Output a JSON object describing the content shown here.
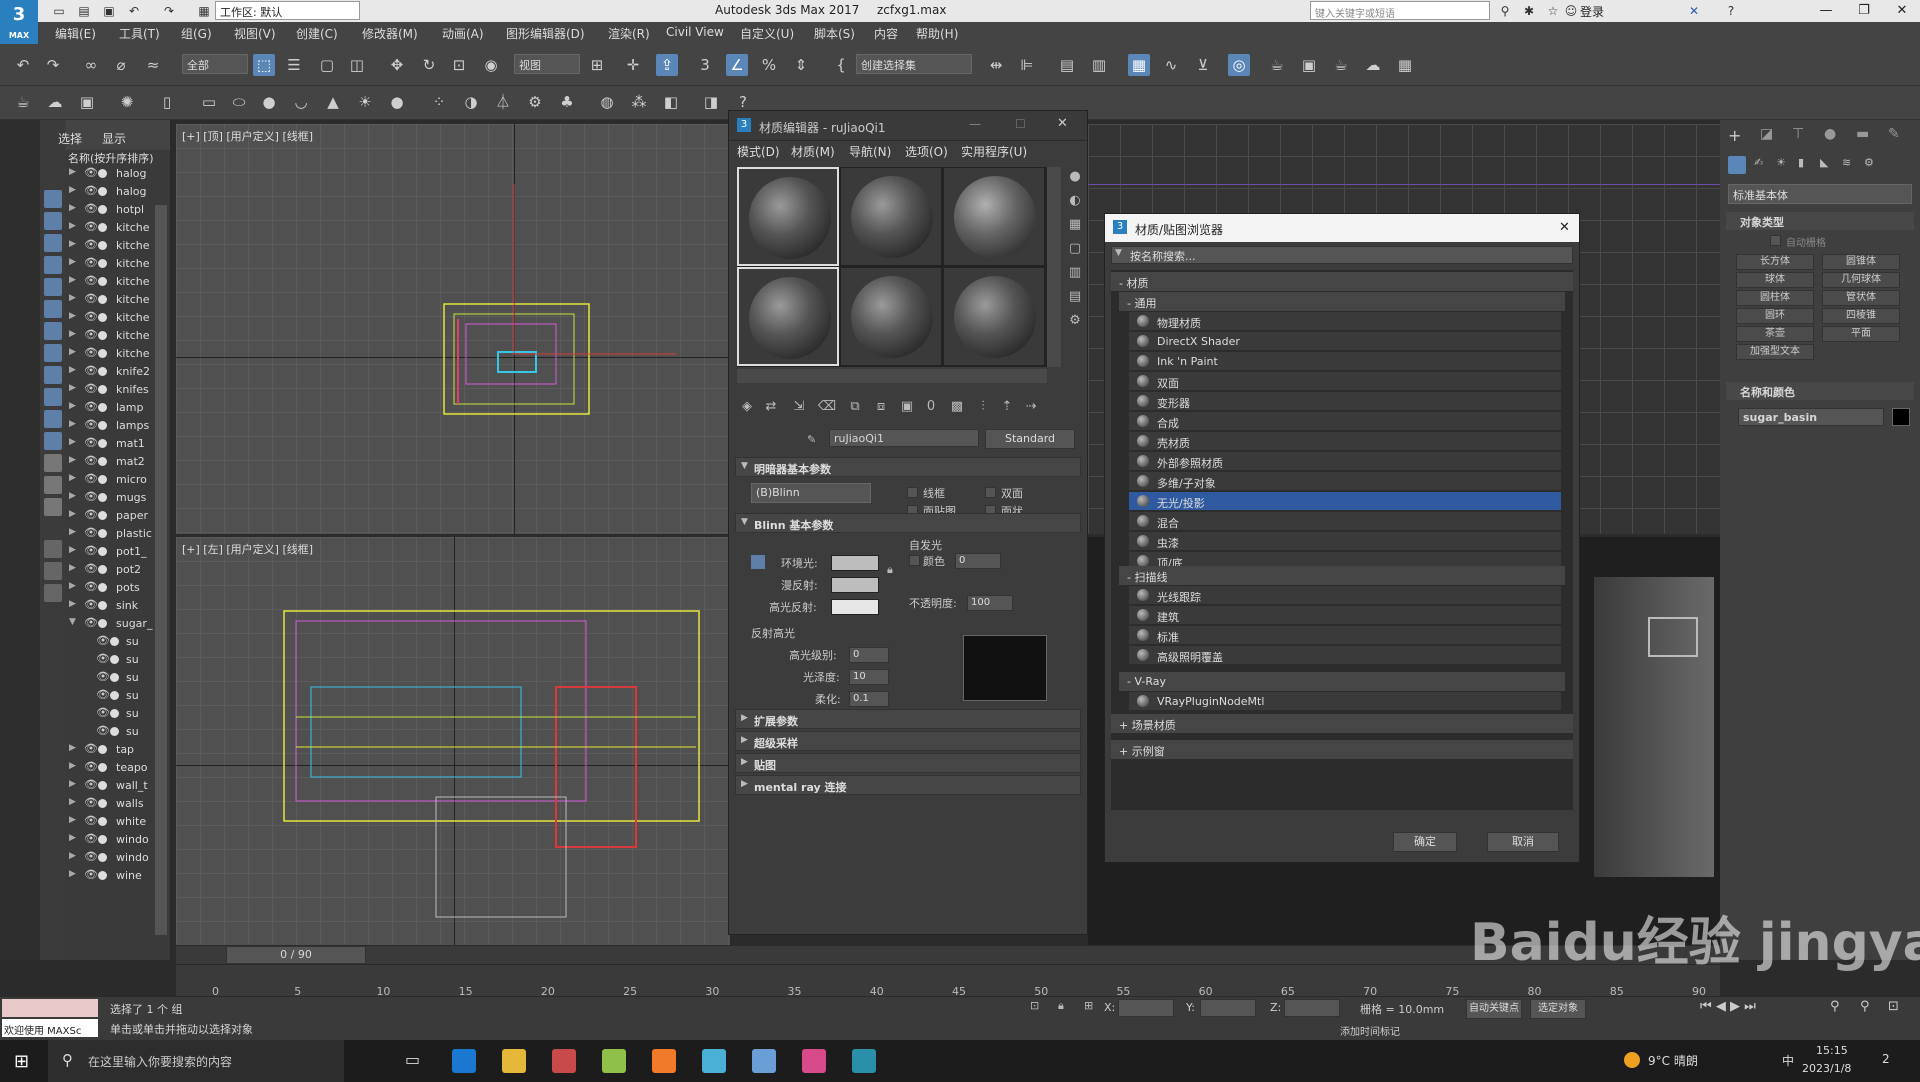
{
  "titlebar": {
    "workspace": "工作区: 默认",
    "app_title": "Autodesk 3ds Max 2017",
    "file_name": "zcfxg1.max",
    "help_search_placeholder": "键入关键字或短语",
    "login": "登录",
    "logo_sub": "MAX"
  },
  "menubar": [
    "编辑(E)",
    "工具(T)",
    "组(G)",
    "视图(V)",
    "创建(C)",
    "修改器(M)",
    "动画(A)",
    "图形编辑器(D)",
    "渲染(R)",
    "Civil View",
    "自定义(U)",
    "脚本(S)",
    "内容",
    "帮助(H)"
  ],
  "toolbar": {
    "filter": "全部",
    "ref_coord": "视图",
    "selection_set": "创建选择集"
  },
  "explorer": {
    "tabs": [
      "选择",
      "显示"
    ],
    "header": "名称(按升序排序)",
    "rows": [
      "halog",
      "halog",
      "hotpl",
      "kitche",
      "kitche",
      "kitche",
      "kitche",
      "kitche",
      "kitche",
      "kitche",
      "kitche",
      "knife2",
      "knifes",
      "lamp",
      "lamps",
      "mat1",
      "mat2",
      "micro",
      "mugs",
      "paper",
      "plastic",
      "pot1_",
      "pot2",
      "pots",
      "sink",
      "sugar_",
      "su",
      "su",
      "su",
      "su",
      "su",
      "su",
      "tap",
      "teapo",
      "wall_t",
      "walls",
      "white",
      "windo",
      "windo",
      "wine"
    ]
  },
  "viewports": {
    "top_label": "[+] [顶] [用户定义] [线框]",
    "left_label": "[+] [左] [用户定义] [线框]"
  },
  "material_editor": {
    "title": "材质编辑器 - ruJiaoQi1",
    "menus": [
      "模式(D)",
      "材质(M)",
      "导航(N)",
      "选项(O)",
      "实用程序(U)"
    ],
    "material_name": "ruJiaoQi1",
    "material_type": "Standard",
    "rollouts": {
      "shader": "明暗器基本参数",
      "blinn": "Blinn 基本参数",
      "extended": "扩展参数",
      "supersampling": "超级采样",
      "maps": "贴图",
      "mentalray": "mental ray 连接"
    },
    "shader_type": "(B)Blinn",
    "checkboxes": [
      "线框",
      "双面",
      "面贴图",
      "面状"
    ],
    "ambient_label": "环境光:",
    "diffuse_label": "漫反射:",
    "specular_label": "高光反射:",
    "self_illum_label": "自发光",
    "color_label": "颜色",
    "self_illum_value": "0",
    "opacity_label": "不透明度:",
    "opacity_value": "100",
    "specular_highlights_label": "反射高光",
    "spec_level_label": "高光级别:",
    "spec_level_value": "0",
    "glossiness_label": "光泽度:",
    "glossiness_value": "10",
    "soften_label": "柔化:",
    "soften_value": "0.1"
  },
  "browser": {
    "title": "材质/贴图浏览器",
    "search_placeholder": "按名称搜索...",
    "section_materials": "- 材质",
    "group_general": "- 通用",
    "general_items": [
      "物理材质",
      "DirectX Shader",
      "Ink 'n Paint",
      "双面",
      "变形器",
      "合成",
      "壳材质",
      "外部参照材质",
      "多维/子对象",
      "无光/投影",
      "混合",
      "虫漆",
      "顶/底"
    ],
    "selected_item": "无光/投影",
    "group_scanline": "- 扫描线",
    "scanline_items": [
      "光线跟踪",
      "建筑",
      "标准",
      "高级照明覆盖"
    ],
    "group_vray": "- V-Ray",
    "vray_items": [
      "VRayPluginNodeMtl"
    ],
    "section_scene": "+ 场景材质",
    "section_samples": "+ 示例窗",
    "ok": "确定",
    "cancel": "取消"
  },
  "command_panel": {
    "dropdown": "标准基本体",
    "object_type_header": "对象类型",
    "auto_grid": "自动栅格",
    "buttons": [
      "长方体",
      "圆锥体",
      "球体",
      "几何球体",
      "圆柱体",
      "管状体",
      "圆环",
      "四棱锥",
      "茶壶",
      "平面",
      "加强型文本"
    ],
    "name_color_header": "名称和颜色",
    "object_name": "sugar_basin"
  },
  "timeline": {
    "frame": "0 / 90",
    "ticks": [
      "0",
      "5",
      "10",
      "15",
      "20",
      "25",
      "30",
      "35",
      "40",
      "45",
      "50",
      "55",
      "60",
      "65",
      "70",
      "75",
      "80",
      "85",
      "90"
    ]
  },
  "status": {
    "welcome": "欢迎使用 MAXSc",
    "selected": "选择了 1 个 组",
    "hint": "单击或单击并拖动以选择对象",
    "x_label": "X:",
    "y_label": "Y:",
    "z_label": "Z:",
    "grid": "栅格 = 10.0mm",
    "add_time_tag": "添加时间标记",
    "auto_key": "自动关键点",
    "selected_obj": "选定对象"
  },
  "taskbar": {
    "search": "在这里输入你要搜索的内容",
    "weather": "9°C 晴朗",
    "ime": "中",
    "time": "15:15",
    "date": "2023/1/8",
    "notifications": "2"
  },
  "watermark": "Baidu经验 jingyan.baidu.com",
  "colors": {
    "accent": "#2f5aa0",
    "title_bg": "#e8e8e8",
    "panel": "#444444",
    "viewport": "#505050"
  }
}
